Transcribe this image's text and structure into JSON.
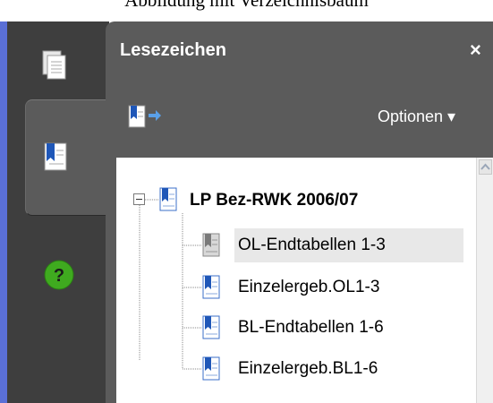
{
  "caption": "Abbildung mit Verzeichnisbaum",
  "panel": {
    "title": "Lesezeichen",
    "close_label": "×",
    "options_label": "Optionen ▾"
  },
  "tree": {
    "root": "LP Bez-RWK 2006/07",
    "children": [
      {
        "label": "OL-Endtabellen 1-3",
        "selected": true
      },
      {
        "label": "Einzelergeb.OL1-3",
        "selected": false
      },
      {
        "label": "BL-Endtabellen 1-6",
        "selected": false
      },
      {
        "label": "Einzelergeb.BL1-6",
        "selected": false
      }
    ]
  },
  "icons": {
    "rail": [
      "pages-icon",
      "bookmarks-icon",
      "help-icon"
    ],
    "help_symbol": "?",
    "colors": {
      "bookmark_blue": "#1f57b8",
      "help_green": "#3faa1f",
      "panel_bg": "#5b5b5b",
      "rail_bg": "#3e3e3e"
    }
  }
}
